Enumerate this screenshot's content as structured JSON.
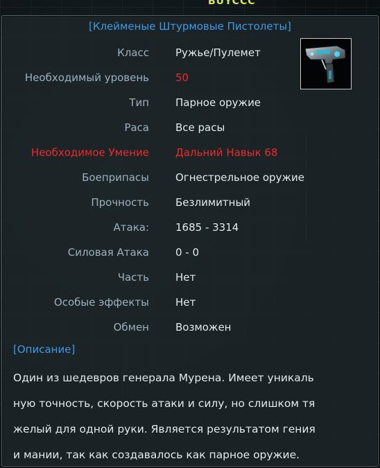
{
  "background": {
    "top_text": "BUYCCC"
  },
  "item": {
    "title": "[Клейменые Штурмовые Пистолеты]",
    "icon": "pistol-icon",
    "stats": [
      {
        "label": "Класс",
        "value": "Ружье/Пулемет",
        "label_color": "#9bb0bf",
        "value_color": "#e4e8ea"
      },
      {
        "label": "Необходимый уровень",
        "value": "50",
        "label_color": "#9bb0bf",
        "value_color": "#ea2b2b"
      },
      {
        "label": "Тип",
        "value": "Парное оружие",
        "label_color": "#9bb0bf",
        "value_color": "#e4e8ea"
      },
      {
        "label": "Раса",
        "value": "Все расы",
        "label_color": "#9bb0bf",
        "value_color": "#e4e8ea"
      },
      {
        "label": "Необходимое Умение",
        "value": "Дальний Навык 68",
        "label_color": "#ea2b2b",
        "value_color": "#ea2b2b"
      },
      {
        "label": "Боеприпасы",
        "value": "Огнестрельное оружие",
        "label_color": "#9bb0bf",
        "value_color": "#e4e8ea"
      },
      {
        "label": "Прочность",
        "value": "Безлимитный",
        "label_color": "#9bb0bf",
        "value_color": "#e4e8ea"
      },
      {
        "label": "Атака:",
        "value": "1685 - 3314",
        "label_color": "#9bb0bf",
        "value_color": "#e4e8ea"
      },
      {
        "label": "Силовая Атака",
        "value": "0 - 0",
        "label_color": "#9bb0bf",
        "value_color": "#e4e8ea"
      },
      {
        "label": "Часть",
        "value": "Нет",
        "label_color": "#9bb0bf",
        "value_color": "#e4e8ea"
      },
      {
        "label": "Особые эффекты",
        "value": "Нет",
        "label_color": "#9bb0bf",
        "value_color": "#e4e8ea"
      },
      {
        "label": "Обмен",
        "value": "Возможен",
        "label_color": "#9bb0bf",
        "value_color": "#e4e8ea"
      }
    ],
    "description_header": "[Описание]",
    "description_lines": [
      "Один из шедевров генерала Мурена. Имеет уникаль",
      "ную точность, скорость атаки и силу, но слишком тя",
      "желый для одной руки. Является результатом гения",
      "и мании, так как создавалось как парное оружие."
    ],
    "colors": {
      "title": "#3d9be4",
      "label": "#9bb0bf",
      "value": "#e4e8ea",
      "warning": "#ea2b2b"
    }
  }
}
